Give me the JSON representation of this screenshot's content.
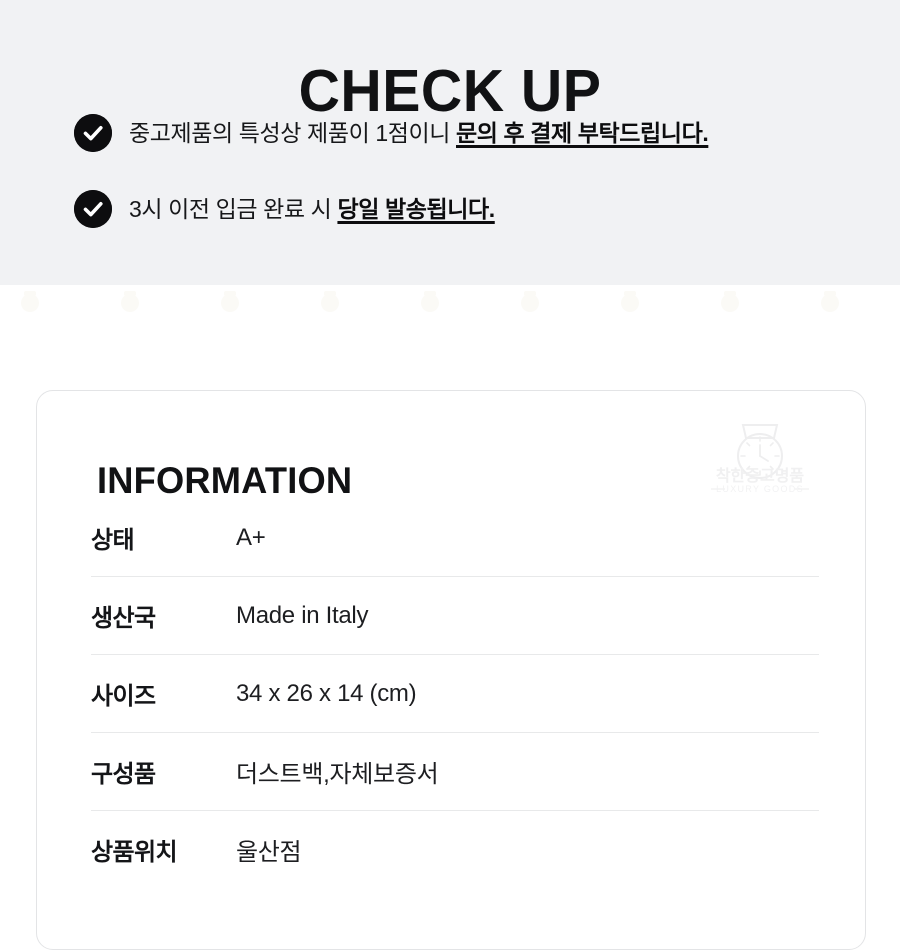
{
  "checkup": {
    "title": "CHECK UP",
    "items": [
      {
        "icon": "check-circle-icon",
        "lead": "중고제품의 특성상 제품이 1점이니 ",
        "emphasis": "문의 후 결제 부탁드립니다."
      },
      {
        "icon": "check-circle-icon",
        "lead": "3시 이전 입금 완료 시 ",
        "emphasis": "당일 발송됩니다."
      }
    ]
  },
  "information": {
    "title": "INFORMATION",
    "watermark": {
      "icon": "wristwatch-icon",
      "brand_kr": "착한중고명품",
      "brand_en": "LUXURY GOODS"
    },
    "rows": [
      {
        "label": "상태",
        "value": "A+"
      },
      {
        "label": "생산국",
        "value": "Made in Italy"
      },
      {
        "label": "사이즈",
        "value": "34 x 26 x 14 (cm)"
      },
      {
        "label": "구성품",
        "value": "더스트백,자체보증서"
      },
      {
        "label": "상품위치",
        "value": "울산점"
      }
    ]
  },
  "colors": {
    "panel_background": "#f1f2f4",
    "page_background": "#ffffff",
    "text_primary": "#111214",
    "icon_fill": "#0d0d0f",
    "card_border": "#e3e4e6",
    "row_divider": "#e8e9ea",
    "watermark": "#f0f0f1"
  }
}
